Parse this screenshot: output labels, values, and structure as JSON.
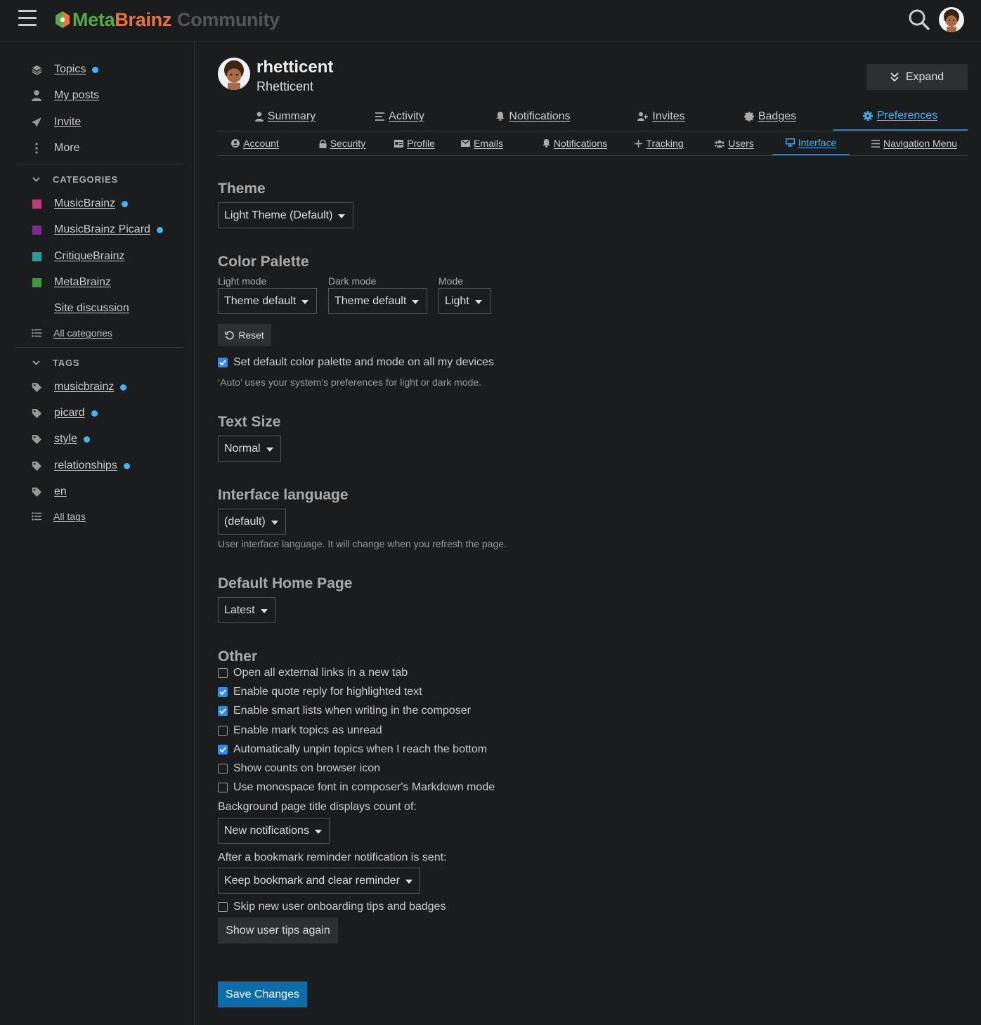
{
  "header": {
    "logo_meta": "Meta",
    "logo_brainz": "Brainz",
    "logo_community": "Community"
  },
  "sidebar": {
    "nav": [
      {
        "label": "Topics",
        "icon": "layers-icon",
        "new": true
      },
      {
        "label": "My posts",
        "icon": "user-icon",
        "new": false
      },
      {
        "label": "Invite",
        "icon": "paper-plane-icon",
        "new": false
      },
      {
        "label": "More",
        "icon": "ellipsis-vertical-icon",
        "new": false
      }
    ],
    "categories_heading": "CATEGORIES",
    "categories": [
      {
        "label": "MusicBrainz",
        "color": "#ba3e7d",
        "new": true
      },
      {
        "label": "MusicBrainz Picard",
        "color": "#7b2f8c",
        "new": true
      },
      {
        "label": "CritiqueBrainz",
        "color": "#2e9a95",
        "new": false
      },
      {
        "label": "MetaBrainz",
        "color": "#3e9a3e",
        "new": false
      },
      {
        "label": "Site discussion",
        "color": "#1b1c1e",
        "new": false
      }
    ],
    "all_categories": "All categories",
    "tags_heading": "TAGS",
    "tags": [
      {
        "label": "musicbrainz",
        "new": true
      },
      {
        "label": "picard",
        "new": true
      },
      {
        "label": "style",
        "new": true
      },
      {
        "label": "relationships",
        "new": true
      },
      {
        "label": "en",
        "new": false
      }
    ],
    "all_tags": "All tags"
  },
  "profile": {
    "username": "rhetticent",
    "full_name": "Rhetticent",
    "expand_label": "Expand"
  },
  "tabs": [
    "Summary",
    "Activity",
    "Notifications",
    "Invites",
    "Badges",
    "Preferences"
  ],
  "pref_tabs": [
    "Account",
    "Security",
    "Profile",
    "Emails",
    "Notifications",
    "Tracking",
    "Users",
    "Interface",
    "Navigation Menu"
  ],
  "active_tab": "Preferences",
  "active_pref_tab": "Interface",
  "theme": {
    "title": "Theme",
    "value": "Light Theme (Default)"
  },
  "palette": {
    "title": "Color Palette",
    "light_label": "Light mode",
    "light_value": "Theme default",
    "dark_label": "Dark mode",
    "dark_value": "Theme default",
    "mode_label": "Mode",
    "mode_value": "Light",
    "reset_label": "Reset",
    "default_all_devices": "Set default color palette and mode on all my devices",
    "default_all_devices_checked": true,
    "help": "‘Auto’ uses your system’s preferences for light or dark mode."
  },
  "text_size": {
    "title": "Text Size",
    "value": "Normal"
  },
  "language": {
    "title": "Interface language",
    "value": "(default)",
    "help": "User interface language. It will change when you refresh the page."
  },
  "home_page": {
    "title": "Default Home Page",
    "value": "Latest"
  },
  "other": {
    "title": "Other",
    "options": [
      {
        "label": "Open all external links in a new tab",
        "checked": false
      },
      {
        "label": "Enable quote reply for highlighted text",
        "checked": true
      },
      {
        "label": "Enable smart lists when writing in the composer",
        "checked": true
      },
      {
        "label": "Enable mark topics as unread",
        "checked": false
      },
      {
        "label": "Automatically unpin topics when I reach the bottom",
        "checked": true
      },
      {
        "label": "Show counts on browser icon",
        "checked": false
      },
      {
        "label": "Use monospace font in composer's Markdown mode",
        "checked": false
      }
    ],
    "title_count_label": "Background page title displays count of:",
    "title_count_value": "New notifications",
    "bookmark_label": "After a bookmark reminder notification is sent:",
    "bookmark_value": "Keep bookmark and clear reminder",
    "skip_onboarding": "Skip new user onboarding tips and badges",
    "skip_onboarding_checked": false,
    "show_tips_label": "Show user tips again"
  },
  "save_label": "Save Changes"
}
